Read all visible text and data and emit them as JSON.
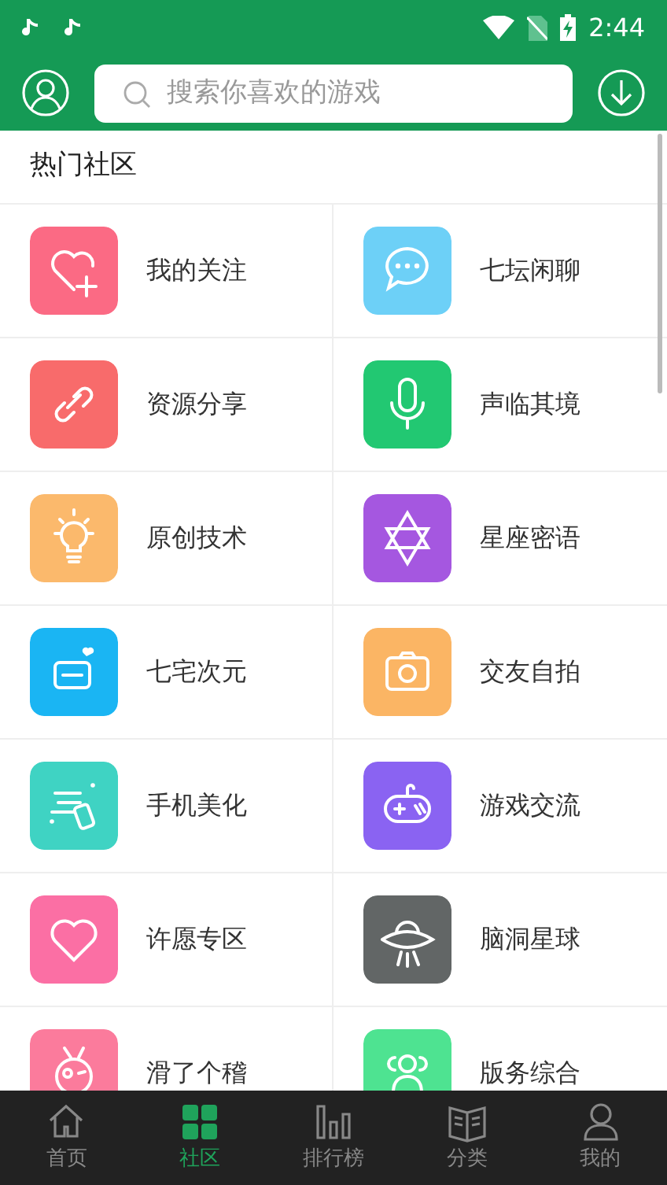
{
  "status_bar": {
    "time": "2:44"
  },
  "search": {
    "placeholder": "搜索你喜欢的游戏"
  },
  "section_title": "热门社区",
  "communities": [
    {
      "label": "我的关注",
      "color": "#fb6a84"
    },
    {
      "label": "七坛闲聊",
      "color": "#6dd0f7"
    },
    {
      "label": "资源分享",
      "color": "#f86b6b"
    },
    {
      "label": "声临其境",
      "color": "#22c872"
    },
    {
      "label": "原创技术",
      "color": "#fbb96c"
    },
    {
      "label": "星座密语",
      "color": "#a557e0"
    },
    {
      "label": "七宅次元",
      "color": "#1ab5f3"
    },
    {
      "label": "交友自拍",
      "color": "#fbb564"
    },
    {
      "label": "手机美化",
      "color": "#3fd3c3"
    },
    {
      "label": "游戏交流",
      "color": "#8a63f2"
    },
    {
      "label": "许愿专区",
      "color": "#fb6fa4"
    },
    {
      "label": "脑洞星球",
      "color": "#626666"
    },
    {
      "label": "滑了个稽",
      "color": "#fb7b9c"
    },
    {
      "label": "版务综合",
      "color": "#4ee391"
    }
  ],
  "tabs": [
    {
      "label": "首页",
      "selected": false
    },
    {
      "label": "社区",
      "selected": true
    },
    {
      "label": "排行榜",
      "selected": false
    },
    {
      "label": "分类",
      "selected": false
    },
    {
      "label": "我的",
      "selected": false
    }
  ]
}
